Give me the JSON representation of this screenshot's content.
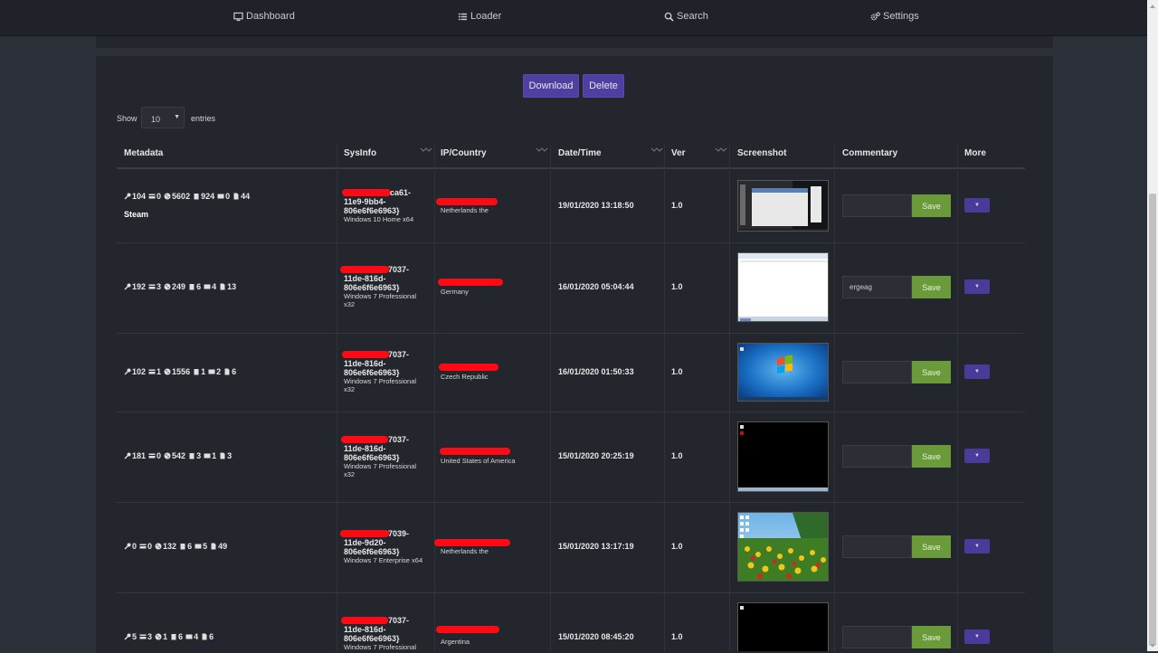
{
  "nav": {
    "dashboard": "Dashboard",
    "loader": "Loader",
    "search": "Search",
    "settings": "Settings"
  },
  "actions": {
    "download": "Download",
    "delete": "Delete"
  },
  "length": {
    "show": "Show",
    "value": "10",
    "entries": "entries"
  },
  "columns": [
    "Metadata",
    "SysInfo",
    "IP/Country",
    "Date/Time",
    "Ver",
    "Screenshot",
    "Commentary",
    "More"
  ],
  "save_label": "Save",
  "rows": [
    {
      "meta": [
        "104",
        "0",
        "5602",
        "924",
        "0",
        "44"
      ],
      "tag": "Steam",
      "sys": [
        "ca61-",
        "11e9-9bb4-",
        "806e6f6e6963}"
      ],
      "os": [
        "Windows 10 Home x64"
      ],
      "country": "Netherlands the",
      "datetime": "19/01/2020 13:18:50",
      "ver": "1.0",
      "comment": ""
    },
    {
      "meta": [
        "192",
        "3",
        "249",
        "6",
        "4",
        "13"
      ],
      "tag": "",
      "sys": [
        "7037-",
        "11de-816d-",
        "806e6f6e6963}"
      ],
      "os": [
        "Windows 7 Professional",
        "x32"
      ],
      "country": "Germany",
      "datetime": "16/01/2020 05:04:44",
      "ver": "1.0",
      "comment": "ergeag"
    },
    {
      "meta": [
        "102",
        "1",
        "1556",
        "1",
        "2",
        "6"
      ],
      "tag": "",
      "sys": [
        "7037-",
        "11de-816d-",
        "806e6f6e6963}"
      ],
      "os": [
        "Windows 7 Professional",
        "x32"
      ],
      "country": "Czech Republic",
      "datetime": "16/01/2020 01:50:33",
      "ver": "1.0",
      "comment": ""
    },
    {
      "meta": [
        "181",
        "0",
        "542",
        "3",
        "1",
        "3"
      ],
      "tag": "",
      "sys": [
        "7037-",
        "11de-816d-",
        "806e6f6e6963}"
      ],
      "os": [
        "Windows 7 Professional",
        "x32"
      ],
      "country": "United States of America",
      "datetime": "15/01/2020 20:25:19",
      "ver": "1.0",
      "comment": ""
    },
    {
      "meta": [
        "0",
        "0",
        "132",
        "6",
        "5",
        "49"
      ],
      "tag": "",
      "sys": [
        "7039-",
        "11de-9d20-",
        "806e6f6e6963}"
      ],
      "os": [
        "Windows 7 Enterprise x64"
      ],
      "country": "Netherlands the",
      "datetime": "15/01/2020 13:17:19",
      "ver": "1.0",
      "comment": ""
    },
    {
      "meta": [
        "5",
        "3",
        "1",
        "6",
        "4",
        "6"
      ],
      "tag": "",
      "sys": [
        "7037-",
        "11de-816d-",
        "806e6f6e6963}"
      ],
      "os": [
        "Windows 7 Professional"
      ],
      "country": "Argentina",
      "datetime": "15/01/2020 08:45:20",
      "ver": "1.0",
      "comment": ""
    }
  ],
  "colors": {
    "background": "#2c3038",
    "panel": "#23262c",
    "purple_button": "#4f3fa0",
    "save_button": "#6a9a3a",
    "redaction": "#ff0a14"
  },
  "icons": [
    "desktop-icon",
    "list-icon",
    "search-icon",
    "gears-icon",
    "key-icon",
    "card-icon",
    "cookie-icon",
    "clipboard-icon",
    "image-icon",
    "file-icon",
    "caret-down-icon"
  ]
}
